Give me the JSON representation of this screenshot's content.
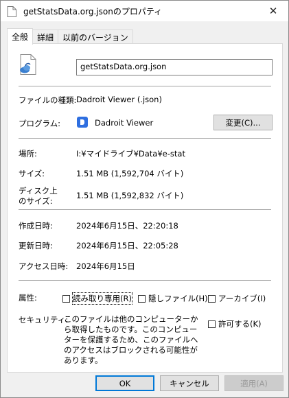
{
  "window": {
    "title": "getStatsData.org.jsonのプロパティ",
    "close_glyph": "✕"
  },
  "tabs": [
    {
      "label": "全般",
      "active": true
    },
    {
      "label": "詳細",
      "active": false
    },
    {
      "label": "以前のバージョン",
      "active": false
    }
  ],
  "general": {
    "file_name": "getStatsData.org.json",
    "file_type_label": "ファイルの種類:",
    "file_type_value": "Dadroit Viewer (.json)",
    "program_label": "プログラム:",
    "program_value": "Dadroit Viewer",
    "change_button": "変更(C)...",
    "location_label": "場所:",
    "location_value": "I:¥マイドライブ¥Data¥e-stat",
    "size_label": "サイズ:",
    "size_value": "1.51 MB (1,592,704 バイト)",
    "disk_size_label_1": "ディスク上",
    "disk_size_label_2": "のサイズ:",
    "disk_size_value": "1.51 MB (1,592,832 バイト)",
    "created_label": "作成日時:",
    "created_value": "2024年6月15日、22:20:18",
    "modified_label": "更新日時:",
    "modified_value": "2024年6月15日、22:05:28",
    "accessed_label": "アクセス日時:",
    "accessed_value": "2024年6月15日",
    "attributes_label": "属性:",
    "attr_readonly": "読み取り専用(R)",
    "attr_hidden": "隠しファイル(H)",
    "attr_archive": "アーカイブ(I)",
    "security_label": "セキュリティ:",
    "security_text": "このファイルは他のコンピューターから取得したものです。このコンピューターを保護するため、このファイルへのアクセスはブロックされる可能性があります。",
    "allow_label": "許可する(K)"
  },
  "buttons": {
    "ok": "OK",
    "cancel": "キャンセル",
    "apply": "適用(A)"
  },
  "colors": {
    "accent": "#0078d7",
    "program_icon": "#2f6fe0"
  },
  "icons": {
    "file": "json-file-icon",
    "program": "dadroit-viewer-icon",
    "close": "close-icon"
  }
}
